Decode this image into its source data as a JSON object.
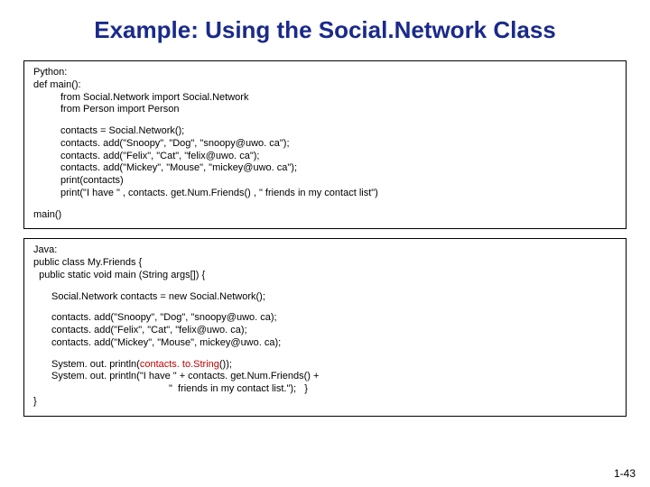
{
  "title": "Example: Using the Social.Network Class",
  "python": {
    "l1": "Python:",
    "l2": "def main():",
    "l3": "from Social.Network import Social.Network",
    "l4": "from Person import Person",
    "l5": "contacts = Social.Network();",
    "l6": "contacts. add(\"Snoopy\", \"Dog\", \"snoopy@uwo. ca\");",
    "l7": "contacts. add(\"Felix\", \"Cat\", \"felix@uwo. ca\");",
    "l8": "contacts. add(\"Mickey\", \"Mouse\", \"mickey@uwo. ca\");",
    "l9": "print(contacts)",
    "l10": "print(\"I have \" , contacts. get.Num.Friends() , \" friends in my contact list\")",
    "l11": "main()"
  },
  "java": {
    "l1": "Java:",
    "l2": "public class My.Friends {",
    "l3": "  public static void main (String args[]) {",
    "l4": "Social.Network contacts = new Social.Network();",
    "l5": "contacts. add(\"Snoopy\", \"Dog\", \"snoopy@uwo. ca);",
    "l6": "contacts. add(\"Felix\", \"Cat\", \"felix@uwo. ca);",
    "l7": "contacts. add(\"Mickey\", \"Mouse\", mickey@uwo. ca);",
    "l8a": "System. out. println(",
    "l8b": "contacts. to.String",
    "l8c": "());",
    "l9": "System. out. println(\"I have \" + contacts. get.Num.Friends() +",
    "l10": "\"  friends in my contact list.\");   }",
    "l11": "}"
  },
  "footer": "1-43"
}
